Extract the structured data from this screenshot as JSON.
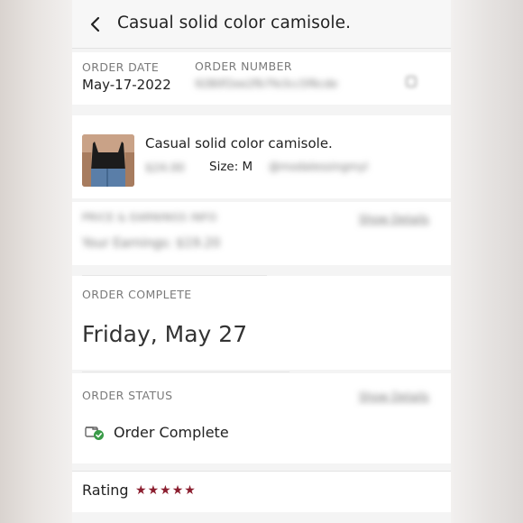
{
  "header": {
    "title": "Casual solid color camisole."
  },
  "order_info": {
    "date_label": "ORDER DATE",
    "date_value": "May-17-2022",
    "number_label": "ORDER NUMBER",
    "number_value": "92B0f2ee2fb7fe3cc5f6cde"
  },
  "item": {
    "title": "Casual solid color camisole.",
    "price": "$24.00",
    "size": "Size: M",
    "extra": "@modalessingmyl"
  },
  "earnings": {
    "label": "PRICE & EARNINGS INFO",
    "link": "Show Details",
    "value": "Your Earnings: $19.20"
  },
  "completion": {
    "label": "ORDER COMPLETE",
    "date": "Friday, May 27"
  },
  "status": {
    "label": "ORDER STATUS",
    "link": "Show Details",
    "text": "Order Complete"
  },
  "rating": {
    "label": "Rating",
    "stars": 5,
    "star_color": "#8b1e2f"
  }
}
